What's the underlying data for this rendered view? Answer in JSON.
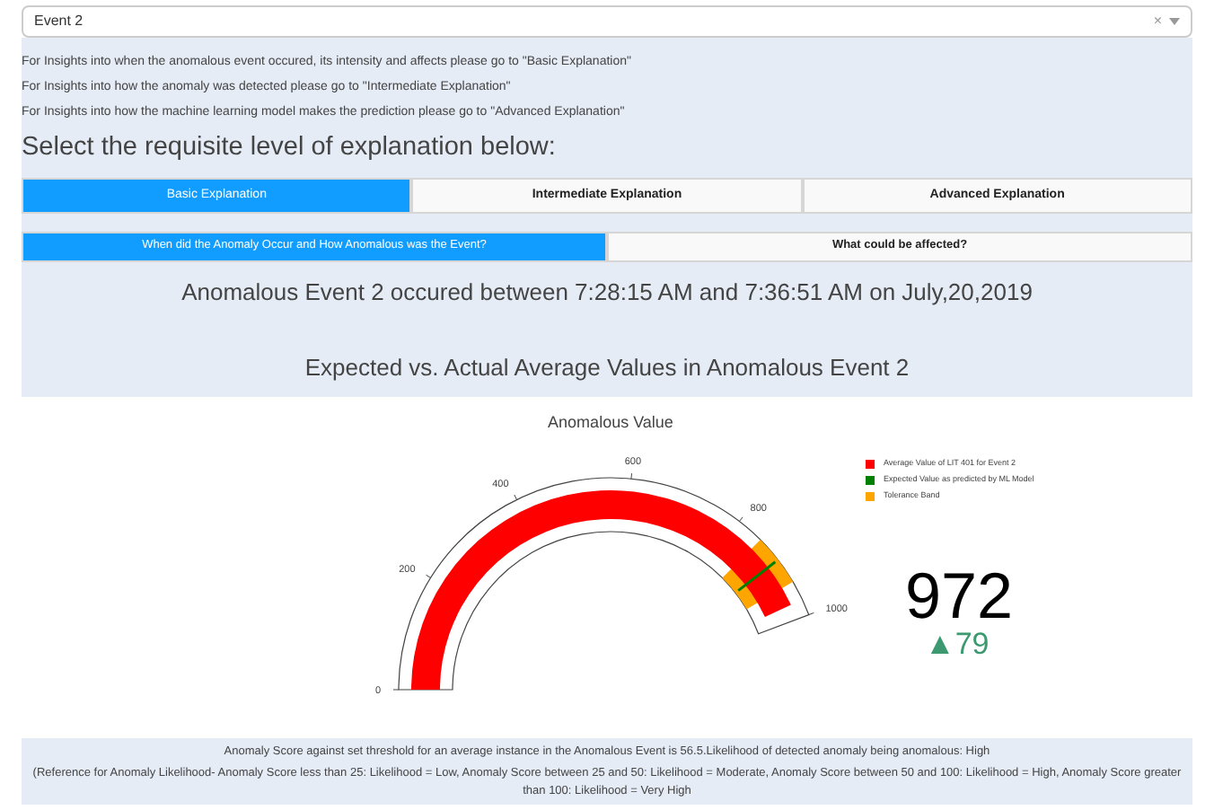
{
  "dropdown": {
    "value": "Event 2",
    "clear": "×"
  },
  "intro": [
    "For Insights into when the anomalous event occured, its intensity and affects please go to \"Basic Explanation\"",
    "For Insights into how the anomaly was detected please go to \"Intermediate Explanation\"",
    "For Insights into how the machine learning model makes the prediction please go to \"Advanced Explanation\""
  ],
  "heading": "Select the requisite level of explanation below:",
  "level_tabs": [
    {
      "label": "Basic Explanation",
      "selected": true
    },
    {
      "label": "Intermediate Explanation",
      "selected": false
    },
    {
      "label": "Advanced Explanation",
      "selected": false
    }
  ],
  "sub_tabs": [
    {
      "label": "When did the Anomaly Occur and How Anomalous was the Event?",
      "selected": true
    },
    {
      "label": "What could be affected?",
      "selected": false
    }
  ],
  "event_summary": "Anomalous Event 2 occured between 7:28:15 AM and 7:36:51 AM on July,20,2019",
  "section_title": "Expected vs. Actual Average Values in Anomalous Event 2",
  "gauge": {
    "title": "Anomalous Value",
    "ticks": [
      "0",
      "200",
      "400",
      "600",
      "800",
      "1000"
    ],
    "legend": [
      {
        "label": "Average Value of LIT 401 for Event 2",
        "color": "#ff0000"
      },
      {
        "label": "Expected Value as predicted by ML Model",
        "color": "#008000"
      },
      {
        "label": "Tolerance Band",
        "color": "#ffa500"
      }
    ],
    "value": "972",
    "delta_arrow": "▲",
    "delta": "79"
  },
  "score_text": "Anomaly Score against set threshold for an average instance in the Anomalous Event is 56.5.Likelihood of detected anomaly being anomalous: High",
  "reference_text": "(Reference for Anomaly Likelihood- Anomaly Score less than 25: Likelihood = Low, Anomaly Score between 25 and 50: Likelihood = Moderate, Anomaly Score between 50 and 100: Likelihood = High, Anomaly Score greater than 100: Likelihood = Very High"
}
